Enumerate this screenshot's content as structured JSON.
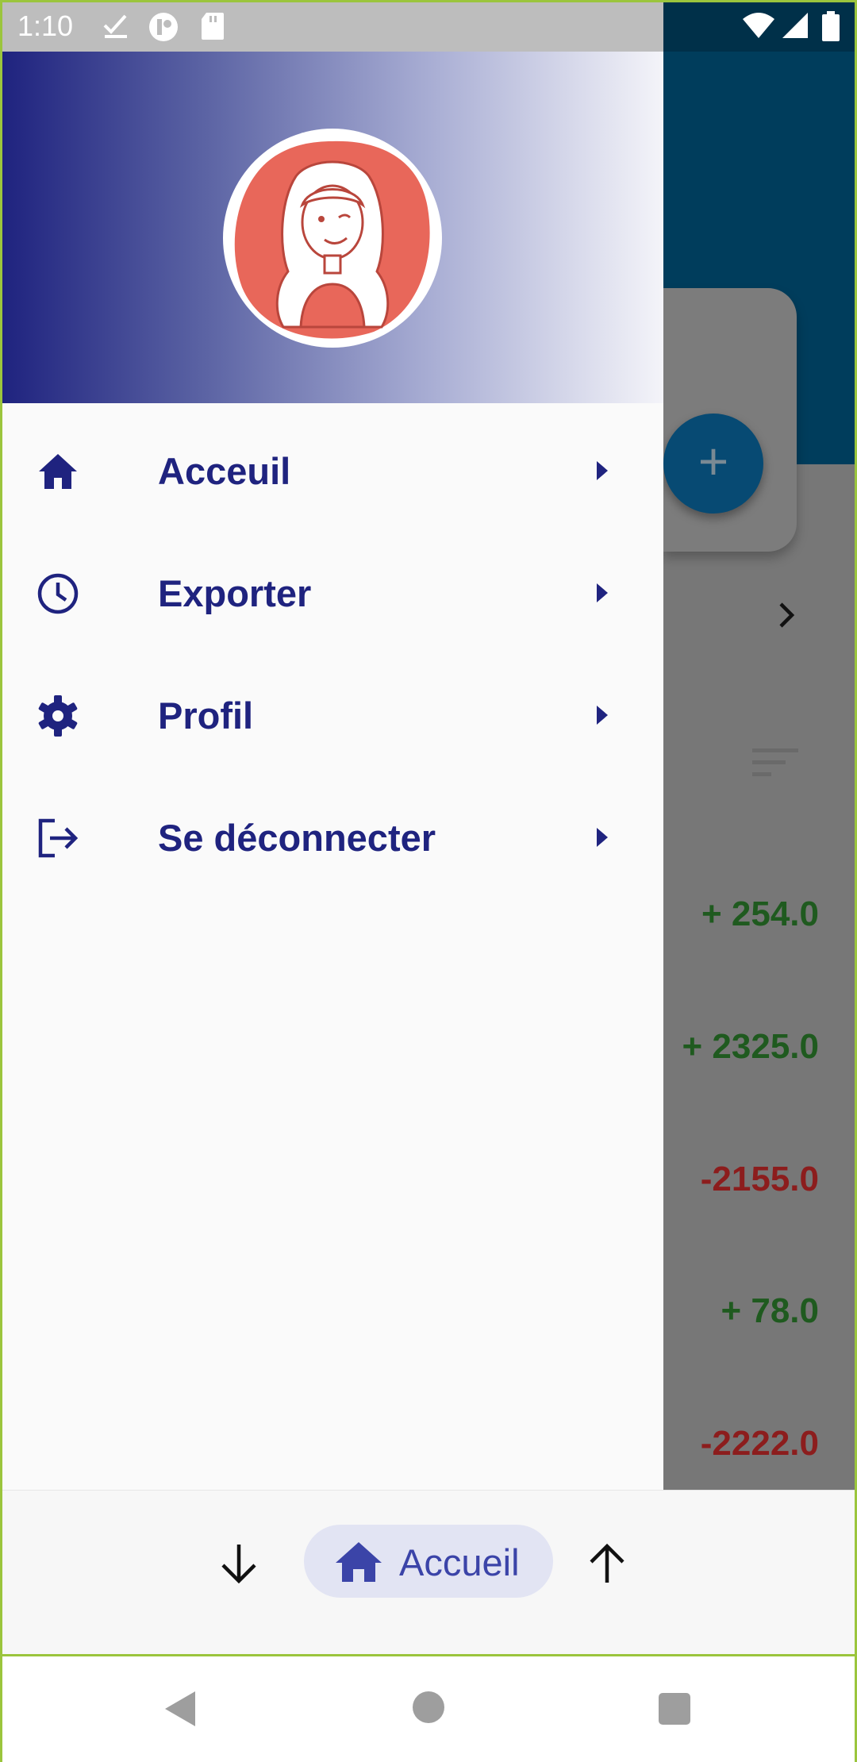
{
  "status_bar": {
    "time": "1:10",
    "icons": [
      "download-done-icon",
      "app-notification-icon",
      "sd-card-icon",
      "wifi-icon",
      "signal-icon",
      "battery-icon"
    ]
  },
  "drawer": {
    "avatar_icon": "user-avatar-illustration",
    "menu": [
      {
        "label": "Acceuil",
        "icon": "home-icon"
      },
      {
        "label": "Exporter",
        "icon": "clock-icon"
      },
      {
        "label": "Profil",
        "icon": "gear-icon"
      },
      {
        "label": "Se déconnecter",
        "icon": "logout-icon"
      }
    ]
  },
  "background": {
    "fab_label": "+",
    "amounts": [
      "+ 254.0",
      "+ 2325.0",
      "-2155.0",
      "+ 78.0",
      "-2222.0"
    ]
  },
  "bottom_nav": {
    "active_label": "Accueil",
    "left_icon": "arrow-down-icon",
    "right_icon": "arrow-up-icon"
  },
  "colors": {
    "primary": "#1f237f",
    "positive": "#1f5a1f",
    "negative": "#8c1d1d",
    "accent_pill": "#e2e4f3"
  }
}
